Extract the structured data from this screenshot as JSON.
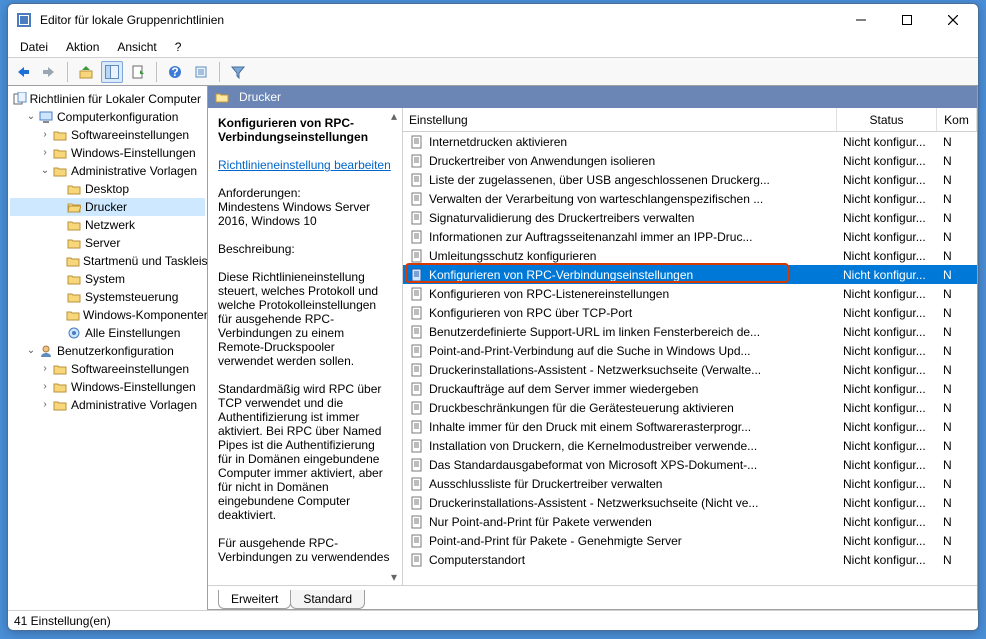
{
  "window": {
    "title": "Editor für lokale Gruppenrichtlinien"
  },
  "menu": {
    "file": "Datei",
    "action": "Aktion",
    "view": "Ansicht",
    "help": "?"
  },
  "tree": {
    "root": "Richtlinien für Lokaler Computer",
    "computer": "Computerkonfiguration",
    "c_software": "Softwareeinstellungen",
    "c_windows": "Windows-Einstellungen",
    "c_admin": "Administrative Vorlagen",
    "desktop": "Desktop",
    "drucker": "Drucker",
    "netzwerk": "Netzwerk",
    "server": "Server",
    "start": "Startmenü und Taskleiste",
    "system": "System",
    "control": "Systemsteuerung",
    "wincomp": "Windows-Komponenten",
    "all": "Alle Einstellungen",
    "user": "Benutzerkonfiguration",
    "u_software": "Softwareeinstellungen",
    "u_windows": "Windows-Einstellungen",
    "u_admin": "Administrative Vorlagen"
  },
  "content": {
    "header": "Drucker"
  },
  "desc": {
    "title": "Konfigurieren von RPC-Verbindungseinstellungen",
    "edit_link": "Richtlinieneinstellung bearbeiten",
    "req_label": "Anforderungen:",
    "req_text": "Mindestens Windows Server 2016, Windows 10",
    "desc_label": "Beschreibung:",
    "p1": "Diese Richtlinieneinstellung steuert, welches Protokoll und welche Protokolleinstellungen für ausgehende RPC-Verbindungen zu einem Remote-Druckspooler verwendet werden sollen.",
    "p2": " Standardmäßig wird RPC über TCP verwendet und die Authentifizierung ist immer aktiviert.  Bei RPC über Named Pipes ist die Authentifizierung für in Domänen eingebundene Computer immer aktiviert, aber für nicht in Domänen eingebundene Computer deaktiviert.",
    "p3": "Für ausgehende RPC-Verbindungen zu verwendendes"
  },
  "list": {
    "col_setting": "Einstellung",
    "col_status": "Status",
    "col_comment": "Kom",
    "status_nc": "Nicht konfigur...",
    "rows": [
      "Internetdrucken aktivieren",
      "Druckertreiber von Anwendungen isolieren",
      "Liste der zugelassenen, über USB angeschlossenen Druckerg...",
      "Verwalten der Verarbeitung von warteschlangenspezifischen ...",
      "Signaturvalidierung des Druckertreibers verwalten",
      "Informationen zur Auftragsseitenanzahl immer an IPP-Druc...",
      "Umleitungsschutz konfigurieren",
      "Konfigurieren von RPC-Verbindungseinstellungen",
      "Konfigurieren von RPC-Listenereinstellungen",
      "Konfigurieren von RPC über TCP-Port",
      "Benutzerdefinierte Support-URL im linken Fensterbereich de...",
      "Point-and-Print-Verbindung auf die Suche in Windows Upd...",
      "Druckerinstallations-Assistent - Netzwerksuchseite (Verwalte...",
      "Druckaufträge auf dem Server immer wiedergeben",
      "Druckbeschränkungen für die Gerätesteuerung aktivieren",
      "Inhalte immer für den Druck mit einem Softwarerasterprogr...",
      "Installation von Druckern, die Kernelmodustreiber verwende...",
      "Das Standardausgabeformat von Microsoft XPS-Dokument-...",
      "Ausschlussliste für Druckertreiber verwalten",
      "Druckerinstallations-Assistent - Netzwerksuchseite (Nicht ve...",
      "Nur Point-and-Print für Pakete verwenden",
      "Point-and-Print für Pakete - Genehmigte Server",
      "Computerstandort"
    ],
    "selected": 7,
    "extra_char": "N"
  },
  "tabs": {
    "extended": "Erweitert",
    "standard": "Standard"
  },
  "status": "41 Einstellung(en)"
}
